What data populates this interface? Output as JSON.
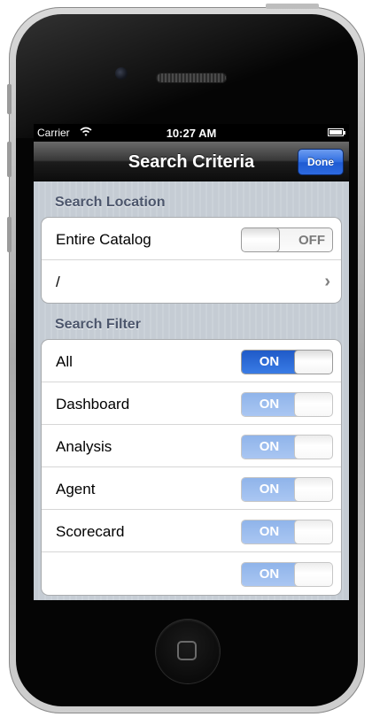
{
  "status_bar": {
    "carrier": "Carrier",
    "time": "10:27 AM"
  },
  "nav_bar": {
    "title": "Search Criteria",
    "done_label": "Done"
  },
  "sections": {
    "location": {
      "header": "Search Location",
      "entire_catalog": {
        "label": "Entire Catalog",
        "state": "OFF"
      },
      "path": {
        "label": "/"
      }
    },
    "filter": {
      "header": "Search Filter",
      "items": [
        {
          "label": "All",
          "state": "ON",
          "enabled": true
        },
        {
          "label": "Dashboard",
          "state": "ON",
          "enabled": false
        },
        {
          "label": "Analysis",
          "state": "ON",
          "enabled": false
        },
        {
          "label": "Agent",
          "state": "ON",
          "enabled": false
        },
        {
          "label": "Scorecard",
          "state": "ON",
          "enabled": false
        },
        {
          "label": "",
          "state": "ON",
          "enabled": false
        }
      ]
    }
  },
  "colors": {
    "switch_on": "#2f6de1",
    "nav_bar": "#1c1c1c",
    "section_header": "#4c566c",
    "done_button": "#2f6de1"
  },
  "icons": {
    "wifi": "wifi-icon",
    "battery": "battery-icon",
    "chevron": "chevron-right-icon"
  }
}
